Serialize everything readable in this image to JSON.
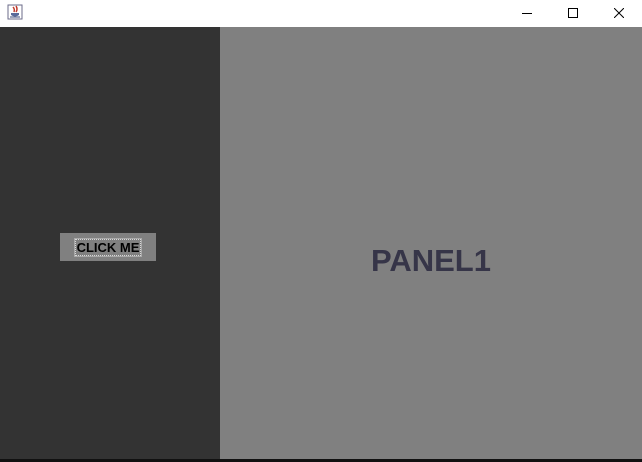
{
  "titlebar": {
    "app_icon": "java-cup-icon",
    "controls": {
      "minimize_icon": "minimize-icon",
      "maximize_icon": "maximize-icon",
      "close_icon": "close-icon"
    }
  },
  "left_panel": {
    "button_label": "CLICK ME"
  },
  "right_panel": {
    "title": "PANEL1"
  },
  "colors": {
    "left_panel_bg": "#333333",
    "right_panel_bg": "#808080",
    "button_bg": "#808080",
    "title_text": "#363548"
  }
}
